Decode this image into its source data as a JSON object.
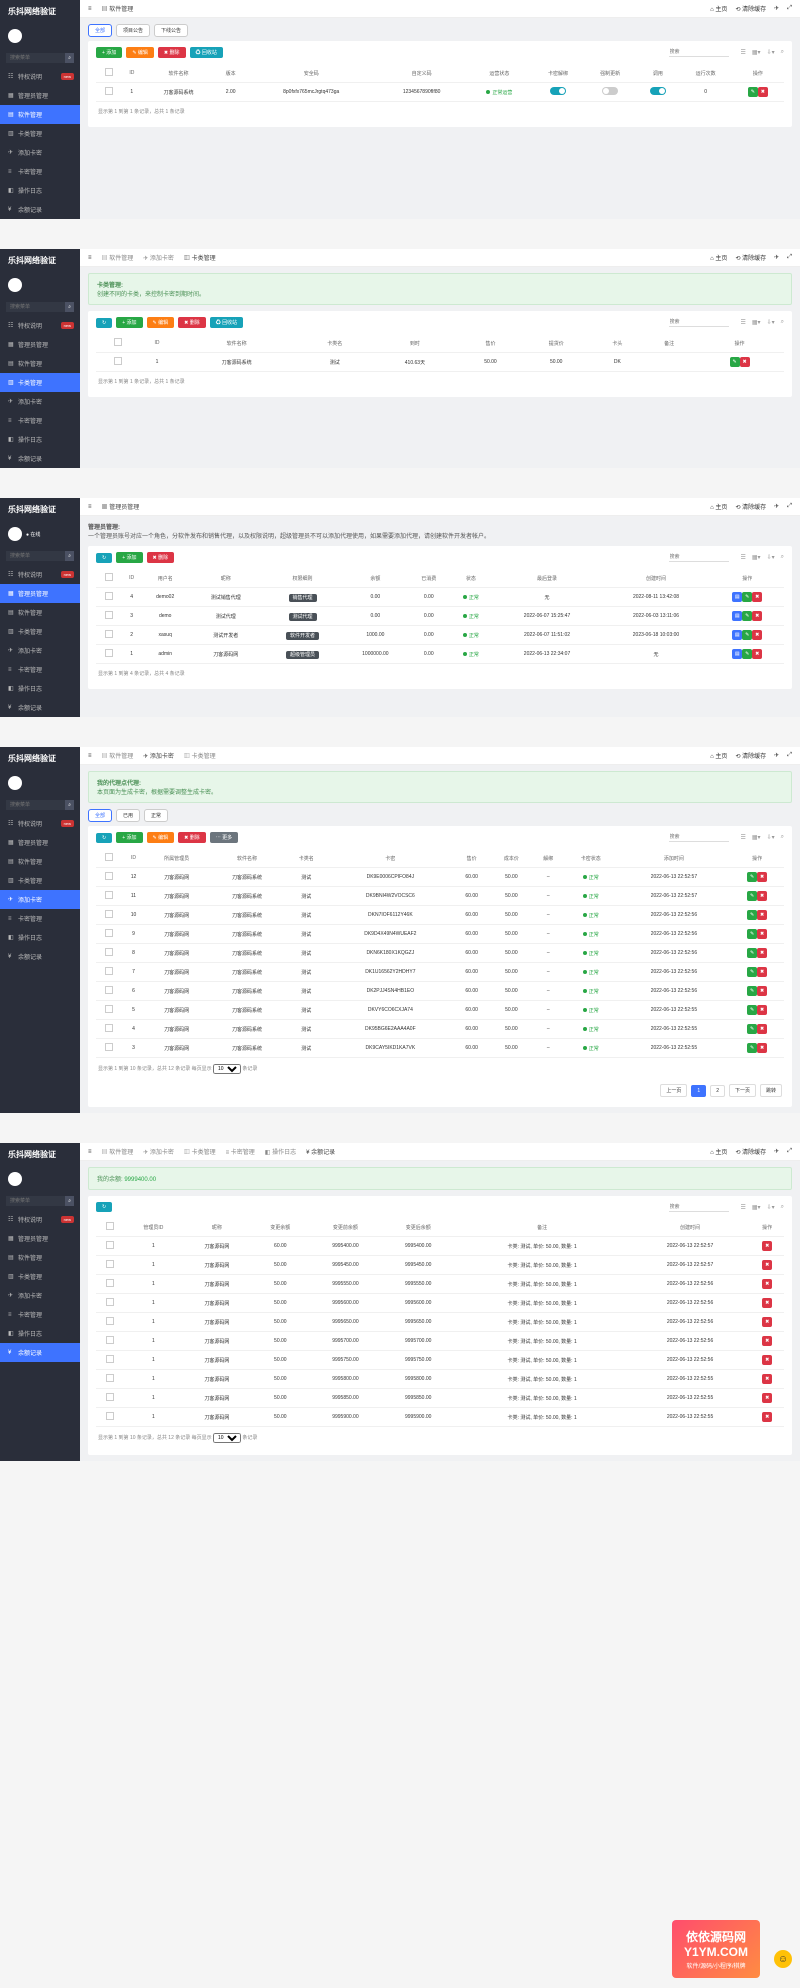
{
  "brand": "乐抖网络验证",
  "sidebar": {
    "search_placeholder": "搜索菜单",
    "items": [
      "特权说明",
      "管理员管理",
      "软件管理",
      "卡类管理",
      "添加卡密",
      "卡密管理",
      "操作日志",
      "余额记录"
    ],
    "badge": "new",
    "online": "在线"
  },
  "topbar": {
    "home": "主页",
    "clear": "清除缓存",
    "ham": "≡"
  },
  "p1": {
    "bc": "软件管理",
    "tabs": [
      "全部",
      "项目公告",
      "下线公告"
    ],
    "btn": {
      "add": "+ 添加",
      "edit": "✎ 编辑",
      "del": "✖ 删除",
      "recycle": "♻ 回收站",
      "search": "搜索"
    },
    "th": [
      "ID",
      "软件名称",
      "版本",
      "安全码",
      "自定义码",
      "运营状态",
      "卡密解绑",
      "强制更新",
      "调用",
      "运行次数",
      "操作"
    ],
    "row": {
      "id": "1",
      "name": "刀客源码系统",
      "ver": "2.00",
      "sec": "8p0fxfx765mcJrgtq473ga",
      "custom": "1234567890fIf80",
      "status": "正常运营",
      "runs": "0"
    },
    "note": "显示第 1 到第 1 条记录，总共 1 条记录"
  },
  "p2": {
    "bc1": "软件管理",
    "bc2": "添加卡密",
    "bc3": "卡类管理",
    "alert": {
      "t": "卡类管理:",
      "d": "创建不同的卡类，来控制卡密到期时间。"
    },
    "btn": {
      "refresh": "↻",
      "add": "+ 添加",
      "edit": "✎ 编辑",
      "del": "✖ 删除",
      "recycle": "♻ 回收站",
      "search": "搜索"
    },
    "th": [
      "ID",
      "软件名称",
      "卡类名",
      "到时",
      "售价",
      "提货价",
      "卡头",
      "备注",
      "操作"
    ],
    "row": {
      "id": "1",
      "soft": "刀客源码系统",
      "name": "测试",
      "time": "410.63天",
      "price": "50.00",
      "cost": "50.00",
      "head": "DK",
      "remark": ""
    },
    "note": "显示第 1 到第 1 条记录，总共 1 条记录"
  },
  "p3": {
    "bc": "管理员管理",
    "desc": {
      "t": "管理员管理:",
      "d": "一个管理员账号对应一个角色，分软件发布和销售代理，以及权限说明，超级管理员不可以添加代理使用，如果需要添加代理，请创建软件开发者帐户。"
    },
    "btn": {
      "refresh": "↻",
      "add": "+ 添加",
      "del": "✖ 删除",
      "search": "搜索"
    },
    "th": [
      "ID",
      "用户名",
      "昵称",
      "权限细则",
      "余额",
      "已消费",
      "状态",
      "最后登录",
      "创建时间",
      "操作"
    ],
    "rows": [
      {
        "id": "4",
        "user": "demo02",
        "nick": "测试销售代理",
        "role": "销售代理",
        "bal": "0.00",
        "used": "0.00",
        "status": "正常",
        "login": "无",
        "create": "2022-08-11 13:42:08"
      },
      {
        "id": "3",
        "user": "demo",
        "nick": "测试代理",
        "role": "测试代理",
        "bal": "0.00",
        "used": "0.00",
        "status": "正常",
        "login": "2022-06-07 15:25:47",
        "create": "2022-06-03 13:11:06"
      },
      {
        "id": "2",
        "user": "xasuq",
        "nick": "测试开发者",
        "role": "软件开发者",
        "bal": "1000.00",
        "used": "0.00",
        "status": "正常",
        "login": "2022-06-07 11:51:02",
        "create": "2023-06-18 10:03:00"
      },
      {
        "id": "1",
        "user": "admin",
        "nick": "刀客源码网",
        "role": "超级管理员",
        "bal": "1000000.00",
        "used": "0.00",
        "status": "正常",
        "login": "2022-06-13 22:34:07",
        "create": "无"
      }
    ],
    "note": "显示第 1 到第 4 条记录，总共 4 条记录"
  },
  "p4": {
    "bc1": "软件管理",
    "bc2": "添加卡密",
    "bc3": "卡类管理",
    "alert": {
      "t": "我的代理点代理:",
      "d": "本页面为生成卡密，根据需要调整生成卡密。"
    },
    "tabs": [
      "全部",
      "已用",
      "正常"
    ],
    "btn": {
      "refresh": "↻",
      "add": "+ 添加",
      "edit": "✎ 编辑",
      "del": "✖ 删除",
      "more": "⋯ 更多",
      "search": "搜索"
    },
    "th": [
      "ID",
      "所属管理员",
      "软件名称",
      "卡类名",
      "卡密",
      "售价",
      "成本价",
      "解绑",
      "卡密状态",
      "添加时间",
      "操作"
    ],
    "rows": [
      {
        "id": "12",
        "mgr": "刀客源码网",
        "soft": "刀客源码系统",
        "cat": "测试",
        "key": "DK9E0006CPIFO84J",
        "price": "60.00",
        "cost": "50.00",
        "unbind": "–",
        "status": "正常",
        "time": "2022-06-13 22:52:57"
      },
      {
        "id": "11",
        "mgr": "刀客源码网",
        "soft": "刀客源码系统",
        "cat": "测试",
        "key": "DK9BNI4W2VOCSC6",
        "price": "60.00",
        "cost": "50.00",
        "unbind": "–",
        "status": "正常",
        "time": "2022-06-13 22:52:57"
      },
      {
        "id": "10",
        "mgr": "刀客源码网",
        "soft": "刀客源码系统",
        "cat": "测试",
        "key": "DKN7IOF6112Y46K",
        "price": "60.00",
        "cost": "50.00",
        "unbind": "–",
        "status": "正常",
        "time": "2022-06-13 22:52:56"
      },
      {
        "id": "9",
        "mgr": "刀客源码网",
        "soft": "刀客源码系统",
        "cat": "测试",
        "key": "DK9D4X49N4WUEAF2",
        "price": "60.00",
        "cost": "50.00",
        "unbind": "–",
        "status": "正常",
        "time": "2022-06-13 22:52:56"
      },
      {
        "id": "8",
        "mgr": "刀客源码网",
        "soft": "刀客源码系统",
        "cat": "测试",
        "key": "DKN6K180X1KQGZJ",
        "price": "60.00",
        "cost": "50.00",
        "unbind": "–",
        "status": "正常",
        "time": "2022-06-13 22:52:56"
      },
      {
        "id": "7",
        "mgr": "刀客源码网",
        "soft": "刀客源码系统",
        "cat": "测试",
        "key": "DK1U16562Y2HDHY7",
        "price": "60.00",
        "cost": "50.00",
        "unbind": "–",
        "status": "正常",
        "time": "2022-06-13 22:52:56"
      },
      {
        "id": "6",
        "mgr": "刀客源码网",
        "soft": "刀客源码系统",
        "cat": "测试",
        "key": "DK2PJJ4SN4HB1EO",
        "price": "60.00",
        "cost": "50.00",
        "unbind": "–",
        "status": "正常",
        "time": "2022-06-13 22:52:56"
      },
      {
        "id": "5",
        "mgr": "刀客源码网",
        "soft": "刀客源码系统",
        "cat": "测试",
        "key": "DKVY6CO6CXJA74",
        "price": "60.00",
        "cost": "50.00",
        "unbind": "–",
        "status": "正常",
        "time": "2022-06-13 22:52:55"
      },
      {
        "id": "4",
        "mgr": "刀客源码网",
        "soft": "刀客源码系统",
        "cat": "测试",
        "key": "DK95BG6E2AAA4A0F",
        "price": "60.00",
        "cost": "50.00",
        "unbind": "–",
        "status": "正常",
        "time": "2022-06-13 22:52:55"
      },
      {
        "id": "3",
        "mgr": "刀客源码网",
        "soft": "刀客源码系统",
        "cat": "测试",
        "key": "DK9CAY5IKD1KA7VK",
        "price": "60.00",
        "cost": "50.00",
        "unbind": "–",
        "status": "正常",
        "time": "2022-06-13 22:52:55"
      }
    ],
    "note": "显示第 1 到第 10 条记录，总共 12 条记录 每页显示",
    "pagesize": "10",
    "rec": "条记录",
    "prev": "上一页",
    "next": "下一页",
    "last": "跳转"
  },
  "p5": {
    "bc1": "软件管理",
    "bc2": "添加卡密",
    "bc3": "卡类管理",
    "bc4": "卡密管理",
    "bc5": "操作日志",
    "bc6": "余额记录",
    "balance_label": "我的余额:",
    "balance": "9999400.00",
    "btn": {
      "refresh": "↻",
      "search": "搜索"
    },
    "th": [
      "管理员ID",
      "昵称",
      "变更余额",
      "变更前余额",
      "变更后余额",
      "备注",
      "创建时间",
      "操作"
    ],
    "rows": [
      {
        "id": "1",
        "nick": "刀客源码网",
        "chg": "60.00",
        "before": "9995400.00",
        "after": "9995400.00",
        "remark": "卡类: 测试, 单价: 50.00, 数量: 1",
        "time": "2022-06-13 22:52:57"
      },
      {
        "id": "1",
        "nick": "刀客源码网",
        "chg": "50.00",
        "before": "9995450.00",
        "after": "9995450.00",
        "remark": "卡类: 测试, 单价: 50.00, 数量: 1",
        "time": "2022-06-13 22:52:57"
      },
      {
        "id": "1",
        "nick": "刀客源码网",
        "chg": "50.00",
        "before": "9995550.00",
        "after": "9995550.00",
        "remark": "卡类: 测试, 单价: 50.00, 数量: 1",
        "time": "2022-06-13 22:52:56"
      },
      {
        "id": "1",
        "nick": "刀客源码网",
        "chg": "50.00",
        "before": "9995600.00",
        "after": "9995600.00",
        "remark": "卡类: 测试, 单价: 50.00, 数量: 1",
        "time": "2022-06-13 22:52:56"
      },
      {
        "id": "1",
        "nick": "刀客源码网",
        "chg": "50.00",
        "before": "9995650.00",
        "after": "9995650.00",
        "remark": "卡类: 测试, 单价: 50.00, 数量: 1",
        "time": "2022-06-13 22:52:56"
      },
      {
        "id": "1",
        "nick": "刀客源码网",
        "chg": "50.00",
        "before": "9995700.00",
        "after": "9995700.00",
        "remark": "卡类: 测试, 单价: 50.00, 数量: 1",
        "time": "2022-06-13 22:52:56"
      },
      {
        "id": "1",
        "nick": "刀客源码网",
        "chg": "50.00",
        "before": "9995750.00",
        "after": "9995750.00",
        "remark": "卡类: 测试, 单价: 50.00, 数量: 1",
        "time": "2022-06-13 22:52:56"
      },
      {
        "id": "1",
        "nick": "刀客源码网",
        "chg": "50.00",
        "before": "9995800.00",
        "after": "9995800.00",
        "remark": "卡类: 测试, 单价: 50.00, 数量: 1",
        "time": "2022-06-13 22:52:55"
      },
      {
        "id": "1",
        "nick": "刀客源码网",
        "chg": "50.00",
        "before": "9995850.00",
        "after": "9995850.00",
        "remark": "卡类: 测试, 单价: 50.00, 数量: 1",
        "time": "2022-06-13 22:52:55"
      },
      {
        "id": "1",
        "nick": "刀客源码网",
        "chg": "50.00",
        "before": "9995900.00",
        "after": "9995900.00",
        "remark": "卡类: 测试, 单价: 50.00, 数量: 1",
        "time": "2022-06-13 22:52:55"
      }
    ],
    "note": "显示第 1 到第 10 条记录，总共 12 条记录 每页显示",
    "pagesize": "10",
    "rec": "条记录"
  },
  "footer": {
    "brand": "依依源码网",
    "url": "Y1YM.COM",
    "sub": "软件/源码/小程序/棋牌"
  }
}
